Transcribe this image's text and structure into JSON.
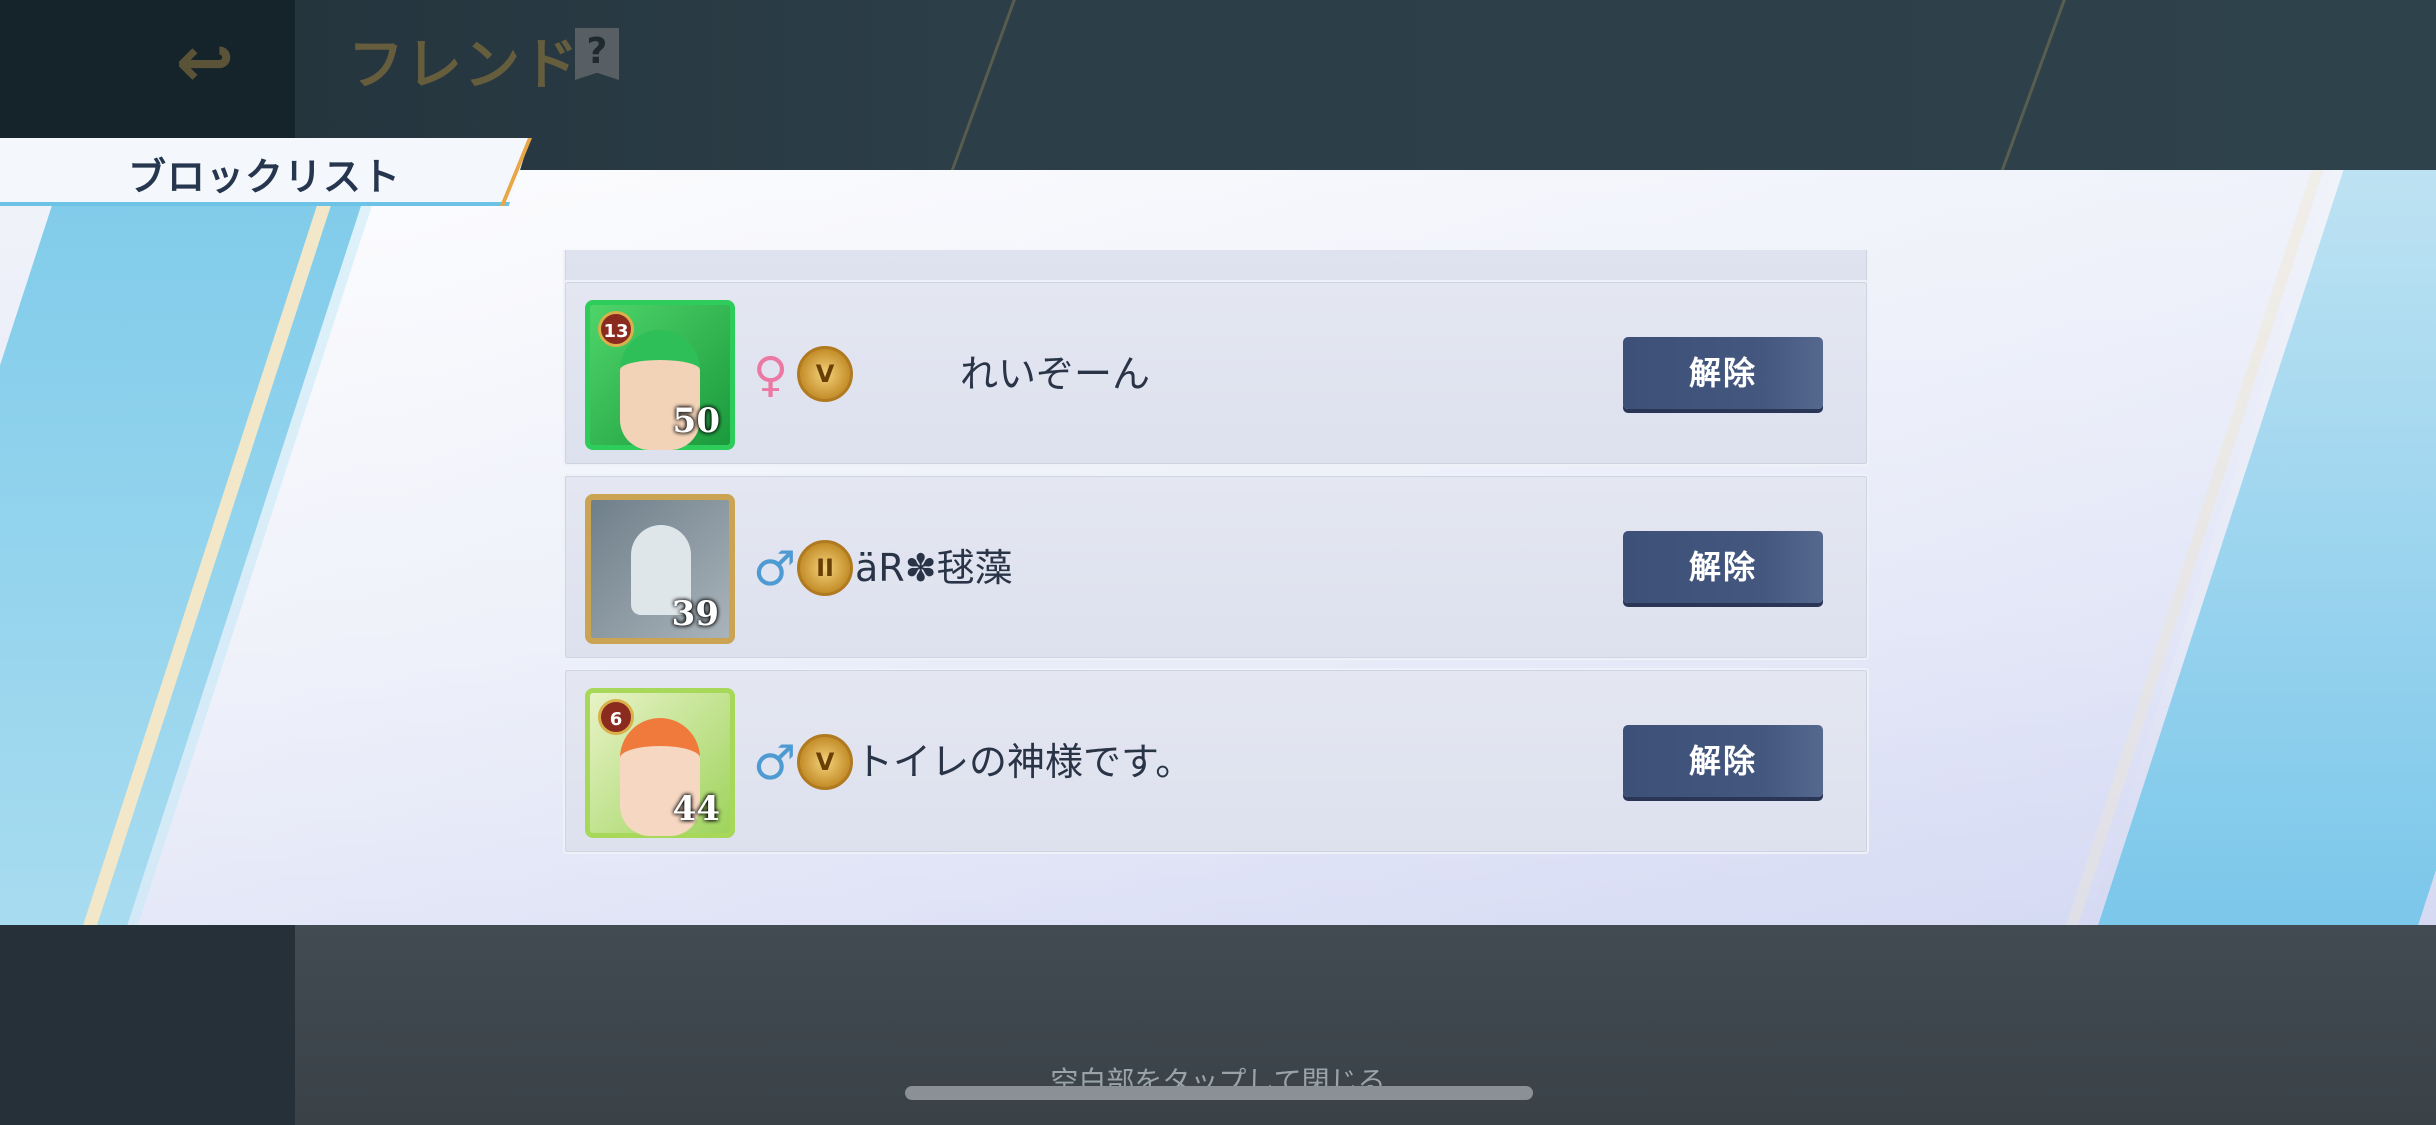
{
  "header": {
    "title": "フレンド",
    "back_icon": "↩",
    "help_label": "?"
  },
  "modal": {
    "tab_title": "ブロックリスト",
    "unblock_label": "解除",
    "rows": [
      {
        "name": "れいぞーん",
        "level": "50",
        "gender": "♀",
        "gender_type": "female",
        "rank_badge": "13",
        "rank_emblem": "V"
      },
      {
        "name": "äR✽毬藻",
        "level": "39",
        "gender": "♂",
        "gender_type": "male",
        "rank_badge": "",
        "rank_emblem": "II"
      },
      {
        "name": "トイレの神様です。",
        "level": "44",
        "gender": "♂",
        "gender_type": "male",
        "rank_badge": "6",
        "rank_emblem": "V"
      }
    ]
  },
  "footer": {
    "close_hint": "空白部をタップして閉じる"
  },
  "colors": {
    "accent_blue": "#6cc3e6",
    "accent_orange": "#e9a646",
    "button_navy": "#3d5078",
    "female": "#ec79a4",
    "male": "#4e9ad2"
  }
}
